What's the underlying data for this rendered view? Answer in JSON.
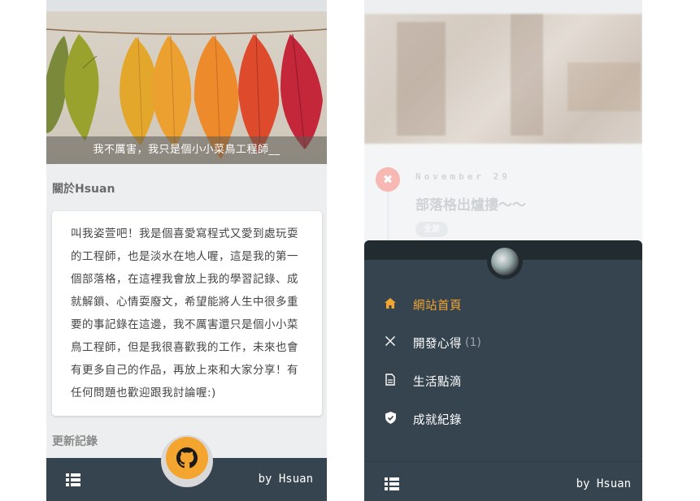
{
  "left": {
    "hero_caption": "我不厲害，我只是個小小菜鳥工程師__",
    "about_title": "關於Hsuan",
    "about_text": "叫我姿萱吧！我是個喜愛寫程式又愛到處玩耍的工程師，也是淡水在地人喔，這是我的第一個部落格，在這裡我會放上我的學習記錄、成就解鎖、心情耍廢文，希望能將人生中很多重要的事記錄在這邊，我不厲害還只是個小小菜鳥工程師，但是我很喜歡我的工作，未來也會有更多自己的作品，再放上來和大家分享！有任何問題也歡迎跟我討論喔:)",
    "update_title": "更新記錄",
    "footer_by": "by Hsuan",
    "menu_icon": "list-icon",
    "fab_icon": "github-icon",
    "accent": "#f3a530",
    "footer_color": "#364450"
  },
  "right": {
    "post": {
      "date": "November 29",
      "title": "部落格出爐摟～～",
      "tag": "全部",
      "icon": "tools-icon"
    },
    "nav": [
      {
        "label": "網站首頁",
        "icon": "home-icon",
        "active": true,
        "count": ""
      },
      {
        "label": "開發心得",
        "icon": "tools-icon",
        "active": false,
        "count": "(1)"
      },
      {
        "label": "生活點滴",
        "icon": "document-icon",
        "active": false,
        "count": ""
      },
      {
        "label": "成就紀錄",
        "icon": "shield-icon",
        "active": false,
        "count": ""
      }
    ],
    "footer_by": "by Hsuan",
    "drawer_color": "#364450"
  }
}
